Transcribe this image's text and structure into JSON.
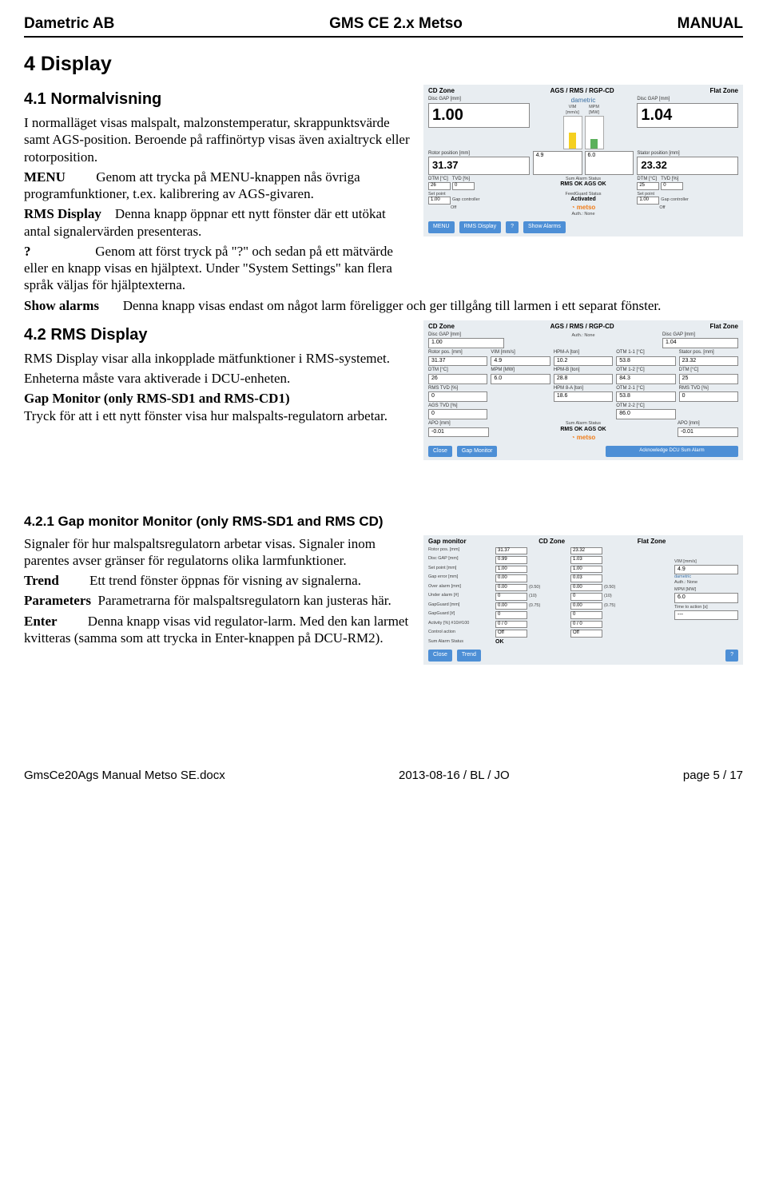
{
  "header": {
    "left": "Dametric AB",
    "center": "GMS CE 2.x Metso",
    "right": "MANUAL"
  },
  "h4": "4   Display",
  "h41": "4.1   Normalvisning",
  "p41a": "I normalläget visas malspalt, malzonstemperatur, skrappunktsvärde samt AGS-position. Beroende på raffinörtyp visas även axialtryck eller rotorposition.",
  "t_menu": "MENU",
  "p_menu": "Genom att trycka på MENU-knappen nås övriga programfunktioner, t.ex. kalibrering av AGS-givaren.",
  "t_rmsd": "RMS Display",
  "p_rmsd": "Denna knapp öppnar ett nytt fönster där ett utökat antal signalervärden presenteras.",
  "t_q": "?",
  "p_q": "Genom att först tryck på \"?\" och sedan på ett mätvärde eller en knapp visas en hjälptext. Under \"System Settings\" kan flera språk väljas för hjälptexterna.",
  "t_sa": "Show alarms",
  "p_sa": "Denna knapp visas endast om något larm föreligger och ger tillgång till larmen i ett separat fönster.",
  "h42": "4.2   RMS Display",
  "p42a": "RMS Display visar alla inkopplade mätfunktioner i RMS-systemet.",
  "p42b": "Enheterna måste vara aktiverade i DCU-enheten.",
  "t_gmon": "Gap Monitor (only RMS-SD1 and RMS-CD1)",
  "p42c": "Tryck för att i ett nytt fönster visa hur malspalts-regulatorn arbetar.",
  "h421": "4.2.1   Gap monitor Monitor (only RMS-SD1 and RMS CD)",
  "p421a": "Signaler för hur malspaltsregulatorn arbetar visas. Signaler inom parentes avser gränser för regulatorns olika larmfunktioner.",
  "t_trend": "Trend",
  "p_trend": "Ett trend fönster öppnas för visning av signalerna.",
  "t_param": "Parameters",
  "p_param": "Parametrarna för malspaltsregulatorn kan justeras här.",
  "t_enter": "Enter",
  "p_enter": "Denna knapp visas vid regulator-larm. Med den kan larmet kvitteras (samma som att trycka in Enter-knappen på DCU-RM2).",
  "footer": {
    "left": "GmsCe20Ags Manual Metso SE.docx",
    "center": "2013-08-16 / BL / JO",
    "right": "page 5 / 17"
  },
  "fig1": {
    "title_center": "AGS / RMS / RGP-CD",
    "brand": "dametric",
    "cd_zone": "CD Zone",
    "flat_zone": "Flat Zone",
    "disc_gap": "Disc GAP [mm]",
    "cd_val": "1.00",
    "flat_val": "1.04",
    "vim": "VIM",
    "vim_u": "[mm/s]",
    "mpm": "MPM",
    "mpm_u": "[MW]",
    "vim_v": "4.9",
    "mpm_v": "6.0",
    "rotor_pos": "Rotor position [mm]",
    "rotor_v": "31.37",
    "stator_pos": "Stator position [mm]",
    "stator_v": "23.32",
    "dtm": "DTM [°C]",
    "tvd": "TVD [%]",
    "dtm1": "26",
    "tvd1": "0",
    "dtm2": "25",
    "tvd2": "0",
    "sum_alarm": "Sum Alarm Status",
    "rms_ok": "RMS OK  AGS OK",
    "sp": "Set point",
    "sp_v": "1.00",
    "gc": "Gap controller",
    "gc_v": "Off",
    "fg": "FeedGuard Status",
    "fg_v": "Activated",
    "metso": "metso",
    "auth": "Auth.: None",
    "b_menu": "MENU",
    "b_rms": "RMS Display",
    "b_q": "?",
    "b_show": "Show Alarms"
  },
  "fig2": {
    "title_center": "AGS / RMS / RGP-CD",
    "cd_zone": "CD Zone",
    "flat_zone": "Flat Zone",
    "disc_gap": "Disc GAP [mm]",
    "cd_v": "1.00",
    "flat_v": "1.04",
    "rotor": "Rotor pos. [mm]",
    "rotor_v": "31.37",
    "vim": "VIM [mm/s]",
    "vim_v": "4.9",
    "hpma": "HPM-A [ton]",
    "hpma_v": "10.2",
    "otm11": "OTM 1-1 [°C]",
    "otm11_v": "53.8",
    "stator": "Stator pos. [mm]",
    "stator_v": "23.32",
    "dtm": "DTM [°C]",
    "dtm_v": "26",
    "mpm": "MPM [MW]",
    "mpm_v": "6.0",
    "hpmb": "HPM-B [ton]",
    "hpmb_v": "28.8",
    "otm12": "OTM 1-2 [°C]",
    "otm12_v": "84.3",
    "dtm2": "DTM [°C]",
    "dtm2_v": "25",
    "rmstvd": "RMS TVD [%]",
    "rmstvd_v": "0",
    "hpm8a": "HPM 8-A [ton]",
    "hpm8a_v": "18.6",
    "otm21": "OTM 2-1 [°C]",
    "otm21_v": "53.8",
    "rmstvd2_v": "0",
    "ags": "AGS TVD [%]",
    "ags_v": "0",
    "otm22": "OTM 2-2 [°C]",
    "otm22_v": "86.0",
    "apo": "APO [mm]",
    "apo_v": "-0.01",
    "sum": "Sum Alarm Status",
    "sum_v": "RMS OK  AGS OK",
    "metso": "metso",
    "auth": "Auth.: None",
    "b_close": "Close",
    "b_gap": "Gap Monitor",
    "b_ack": "Acknowledge DCU Sum Alarm"
  },
  "fig3": {
    "title": "Gap monitor",
    "cd": "CD Zone",
    "flat": "Flat Zone",
    "vim": "VIM [mm/s]",
    "vim_v": "4.9",
    "brand": "dametric",
    "auth": "Auth.: None",
    "mpm": "MPM [MW]",
    "mpm_v": "6.0",
    "tta": "Time to action [s]",
    "tta_v": "---",
    "rows": [
      {
        "l": "Rotor pos. [mm]",
        "a": "31.37",
        "b": "23.32"
      },
      {
        "l": "Disc GAP [mm]",
        "a": "0.99",
        "b": "1.03"
      },
      {
        "l": "Set point [mm]",
        "a": "1.00",
        "b": "1.00"
      },
      {
        "l": "Gap error [mm]",
        "a": "0.00",
        "b": "0.03"
      },
      {
        "l": "Over alarm [mm]",
        "a": "0.00",
        "ax": "(0.50)",
        "b": "0.00",
        "bx": "(0.50)"
      },
      {
        "l": "Under alarm [#]",
        "a": "0",
        "ax": "(10)",
        "b": "0",
        "bx": "(10)"
      },
      {
        "l": "GapGuard [mm]",
        "a": "0.00",
        "ax": "(0.75)",
        "b": "0.00",
        "bx": "(0.75)"
      },
      {
        "l": "GapGuard [#]",
        "a": "0",
        "b": "0"
      },
      {
        "l": "Activity [%] #10/#100",
        "a": "0 / 0",
        "b": "0 / 0"
      },
      {
        "l": "Control action",
        "a": "Off",
        "b": "Off"
      }
    ],
    "sum": "Sum Alarm Status",
    "sum_v": "OK",
    "b_close": "Close",
    "b_trend": "Trend",
    "b_q": "?"
  }
}
